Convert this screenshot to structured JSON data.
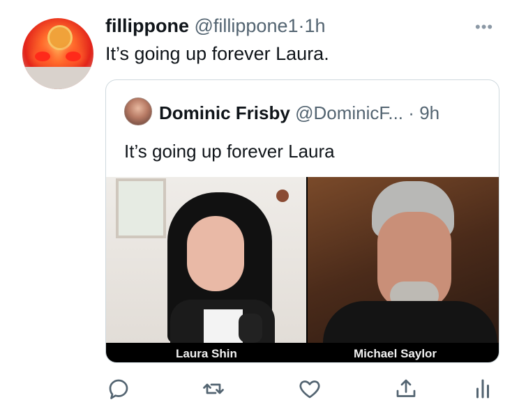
{
  "tweet": {
    "name": "fillippone",
    "handle": "@fillippone1",
    "separator": "·",
    "time": "1h",
    "text": "It’s going up forever Laura.",
    "more_icon": "more-horizontal-icon"
  },
  "quote": {
    "name": "Dominic Frisby",
    "handle": "@DominicF...",
    "separator": "·",
    "time": "9h",
    "text": "It’s going up forever Laura",
    "video": {
      "left_caption": "Laura Shin",
      "right_caption": "Michael Saylor"
    }
  },
  "actions": [
    "reply-icon",
    "retweet-icon",
    "like-icon",
    "share-icon",
    "analytics-icon"
  ],
  "colors": {
    "text": "#0f1419",
    "secondary": "#536471",
    "border": "#cfd9de",
    "icon": "#536471"
  }
}
